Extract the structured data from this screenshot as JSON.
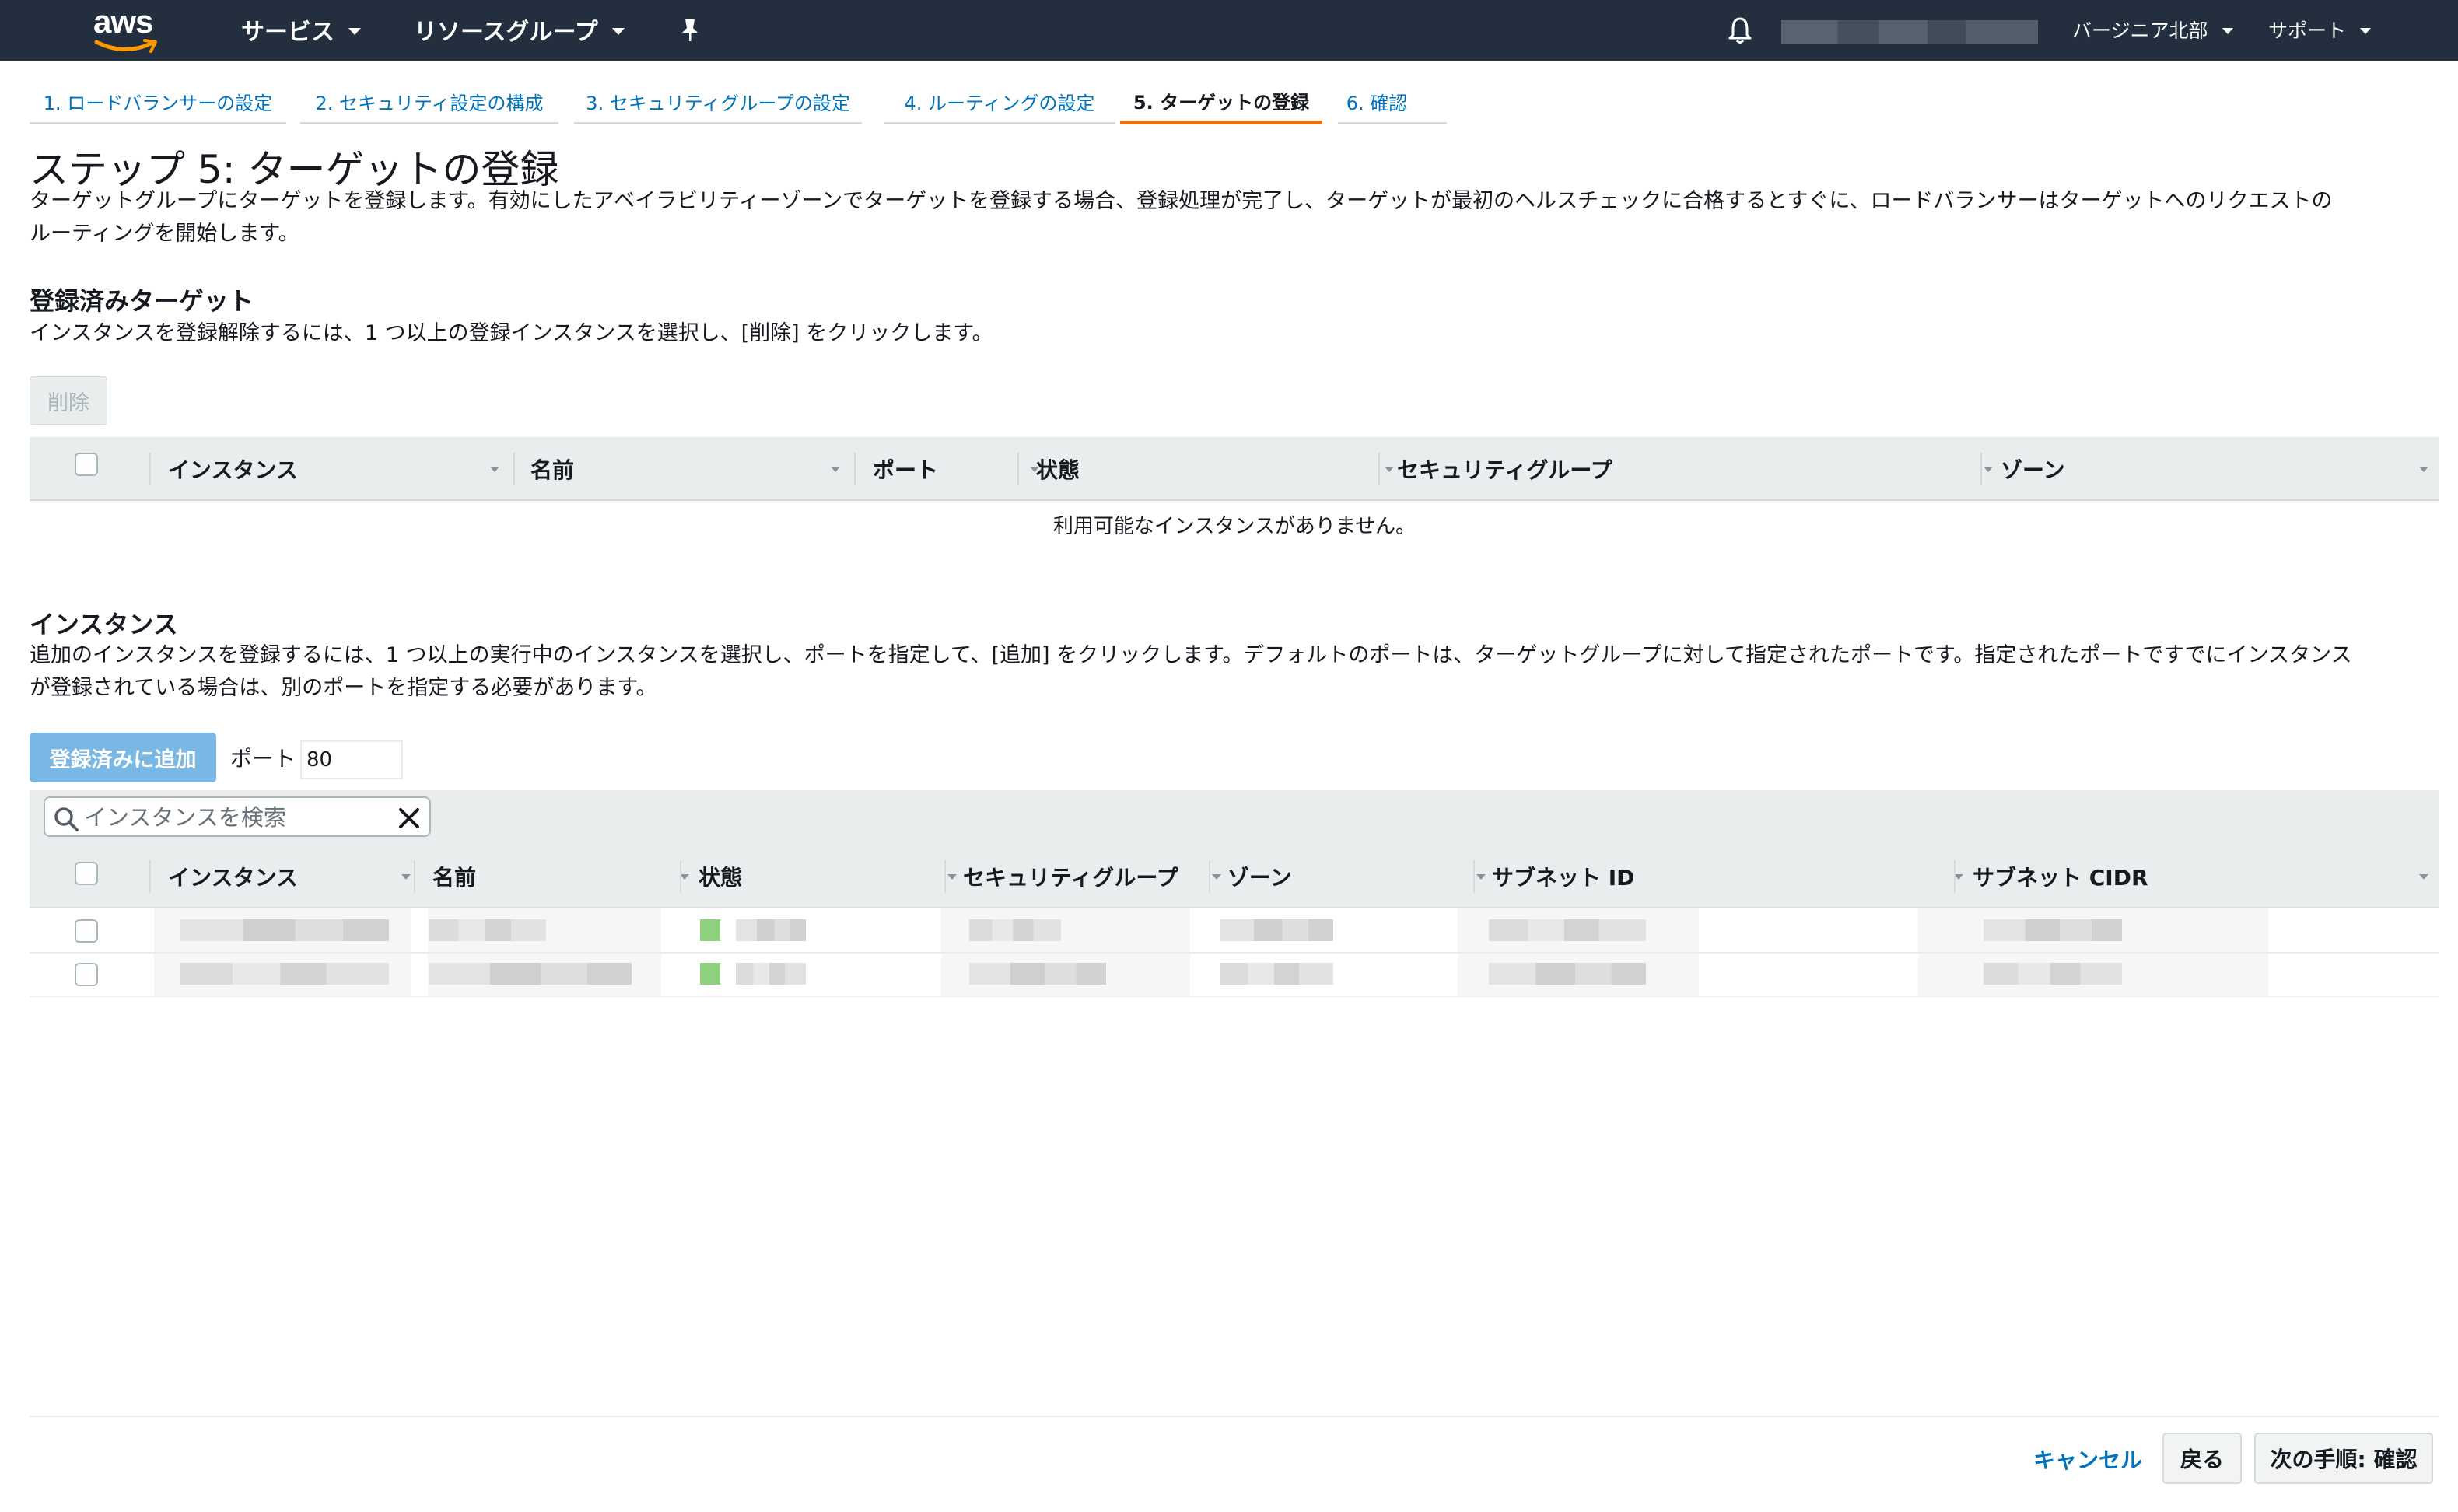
{
  "topnav": {
    "logo_text": "aws",
    "services_label": "サービス",
    "resource_groups_label": "リソースグループ",
    "region_label": "バージニア北部",
    "support_label": "サポート",
    "icons": [
      "pin-icon",
      "bell-icon"
    ],
    "bg_color": "#232f3e"
  },
  "wizard": {
    "tabs": [
      {
        "label": "1. ロードバランサーの設定"
      },
      {
        "label": "2. セキュリティ設定の構成"
      },
      {
        "label": "3. セキュリティグループの設定"
      },
      {
        "label": "4. ルーティングの設定"
      },
      {
        "label": "5. ターゲットの登録"
      },
      {
        "label": "6. 確認"
      }
    ],
    "active_tab": "5. ターゲットの登録",
    "active_color": "#ec7211"
  },
  "page": {
    "title": "ステップ 5: ターゲットの登録",
    "description_line1": "ターゲットグループにターゲットを登録します。有効にしたアベイラビリティーゾーンでターゲットを登録する場合、登録処理が完了し、ターゲットが最初のヘルスチェックに合格するとすぐに、ロードバランサーはターゲットへのリクエストの",
    "description_line2": "ルーティングを開始します。"
  },
  "registered": {
    "title": "登録済みターゲット",
    "description": "インスタンスを登録解除するには、1 つ以上の登録インスタンスを選択し、[削除] をクリックします。",
    "remove_label": "削除",
    "columns": [
      "インスタンス",
      "名前",
      "ポート",
      "状態",
      "セキュリティグループ",
      "ゾーン"
    ],
    "empty_message": "利用可能なインスタンスがありません。"
  },
  "instances": {
    "title": "インスタンス",
    "description_line1": "追加のインスタンスを登録するには、1 つ以上の実行中のインスタンスを選択し、ポートを指定して、[追加] をクリックします。デフォルトのポートは、ターゲットグループに対して指定されたポートです。指定されたポートですでにインスタンス",
    "description_line2": "が登録されている場合は、別のポートを指定する必要があります。",
    "add_label": "登録済みに追加",
    "port_label": "ポート",
    "port_value": "80",
    "search_placeholder": "インスタンスを検索",
    "columns": [
      "インスタンス",
      "名前",
      "状態",
      "セキュリティグループ",
      "ゾーン",
      "サブネット ID",
      "サブネット CIDR"
    ],
    "rows": [
      {},
      {}
    ],
    "state_color": "#8fd07f"
  },
  "footer": {
    "cancel_label": "キャンセル",
    "back_label": "戻る",
    "next_label": "次の手順: 確認"
  }
}
